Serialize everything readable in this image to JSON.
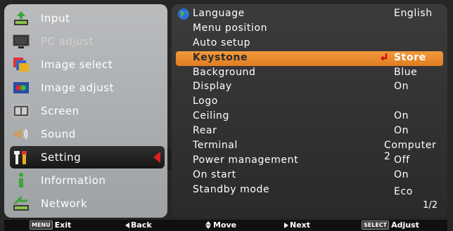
{
  "left_menu": {
    "items": [
      {
        "label": "Input",
        "icon": "input-icon",
        "state": "normal"
      },
      {
        "label": "PC adjust",
        "icon": "monitor-icon",
        "state": "disabled"
      },
      {
        "label": "Image select",
        "icon": "image-select-icon",
        "state": "normal"
      },
      {
        "label": "Image adjust",
        "icon": "image-adjust-icon",
        "state": "normal"
      },
      {
        "label": "Screen",
        "icon": "screen-icon",
        "state": "normal"
      },
      {
        "label": "Sound",
        "icon": "speaker-icon",
        "state": "normal"
      },
      {
        "label": "Setting",
        "icon": "setting-icon",
        "state": "active"
      },
      {
        "label": "Information",
        "icon": "information-icon",
        "state": "normal"
      },
      {
        "label": "Network",
        "icon": "network-icon",
        "state": "normal"
      }
    ]
  },
  "settings": {
    "rows": [
      {
        "label": "Language",
        "value": "English"
      },
      {
        "label": "Menu position",
        "value": ""
      },
      {
        "label": "Auto setup",
        "value": ""
      },
      {
        "label": "Keystone",
        "value": "Store",
        "selected": true
      },
      {
        "label": "Background",
        "value": "Blue"
      },
      {
        "label": "Display",
        "value": "On"
      },
      {
        "label": "Logo",
        "value": ""
      },
      {
        "label": "Ceiling",
        "value": "On"
      },
      {
        "label": "Rear",
        "value": "On"
      },
      {
        "label": "Terminal",
        "value": "Computer 2"
      },
      {
        "label": "Power management",
        "value": "Off"
      },
      {
        "label": "On start",
        "value": "On"
      },
      {
        "label": "Standby mode",
        "value": "Eco"
      }
    ],
    "page": "1/2"
  },
  "bottom_bar": {
    "menu_badge": "MENU",
    "exit": "Exit",
    "back": "Back",
    "move": "Move",
    "next": "Next",
    "select_badge": "SELECT",
    "adjust": "Adjust"
  },
  "colors": {
    "selected_row": "#e88a2e",
    "active_arrow": "#e02020",
    "left_panel": "#aeb0b3",
    "right_panel": "#333333"
  }
}
